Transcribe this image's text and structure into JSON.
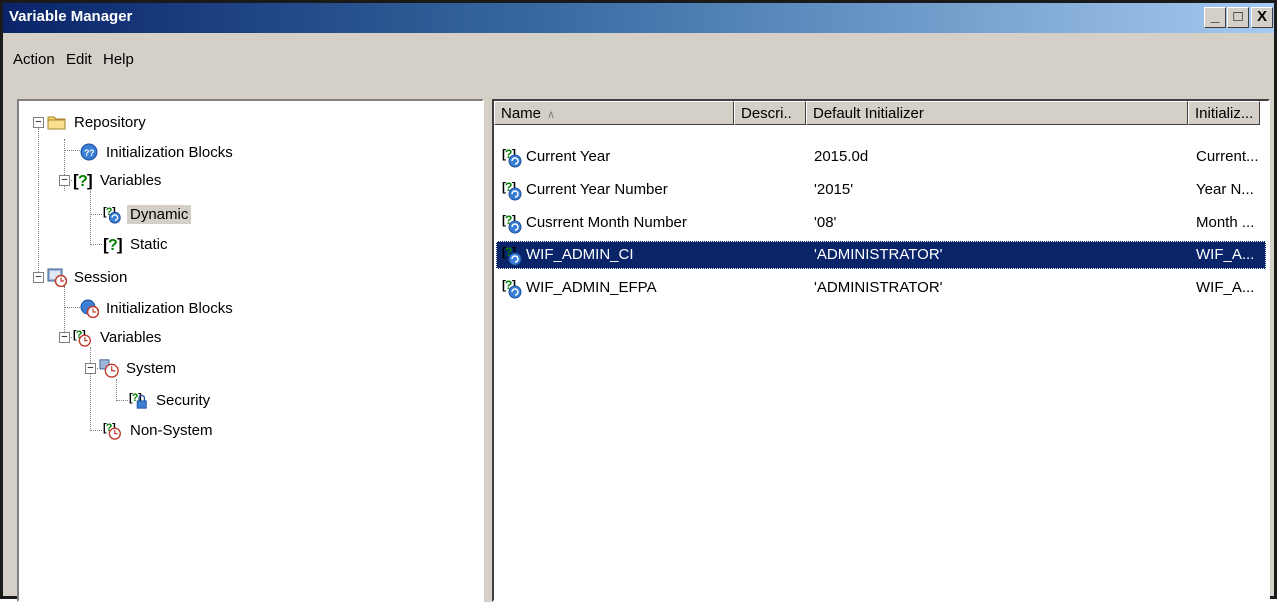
{
  "window": {
    "title": "Variable Manager",
    "controls": {
      "minimize": "_",
      "maximize": "□",
      "close": "X"
    }
  },
  "menu": {
    "items": [
      "Action",
      "Edit",
      "Help"
    ]
  },
  "tree": {
    "repository": "Repository",
    "repo_init_blocks": "Initialization Blocks",
    "repo_variables": "Variables",
    "dynamic": "Dynamic",
    "static": "Static",
    "session": "Session",
    "session_init_blocks": "Initialization Blocks",
    "session_variables": "Variables",
    "system": "System",
    "security": "Security",
    "non_system": "Non-System",
    "expand_minus": "−"
  },
  "list": {
    "columns": [
      "Name",
      "Descri..",
      "Default Initializer",
      "Initializ..."
    ],
    "sort_indicator": "∧",
    "rows": [
      {
        "name": "Current Year",
        "description": "",
        "default": "2015.0d",
        "initializer": "Current..."
      },
      {
        "name": "Current Year Number",
        "description": "",
        "default": "'2015'",
        "initializer": "Year N..."
      },
      {
        "name": "Cusrrent Month Number",
        "description": "",
        "default": "'08'",
        "initializer": "Month ..."
      },
      {
        "name": "WIF_ADMIN_CI",
        "description": "",
        "default": "'ADMINISTRATOR'",
        "initializer": "WIF_A..."
      },
      {
        "name": "WIF_ADMIN_EFPA",
        "description": "",
        "default": "'ADMINISTRATOR'",
        "initializer": "WIF_A..."
      }
    ],
    "selected_row_index": 3
  },
  "colors": {
    "titlebar_start": "#0a246a",
    "titlebar_end": "#a6caf0",
    "selection": "#0a246a",
    "chrome": "#d4d0c8"
  },
  "icons": {
    "folder": "folder-icon",
    "init_block": "initialization-block-icon",
    "variable": "question-variable-icon",
    "dynamic_variable": "dynamic-variable-icon",
    "session": "session-icon",
    "session_variable": "session-variable-icon",
    "system": "system-variable-icon",
    "security": "security-variable-icon"
  }
}
